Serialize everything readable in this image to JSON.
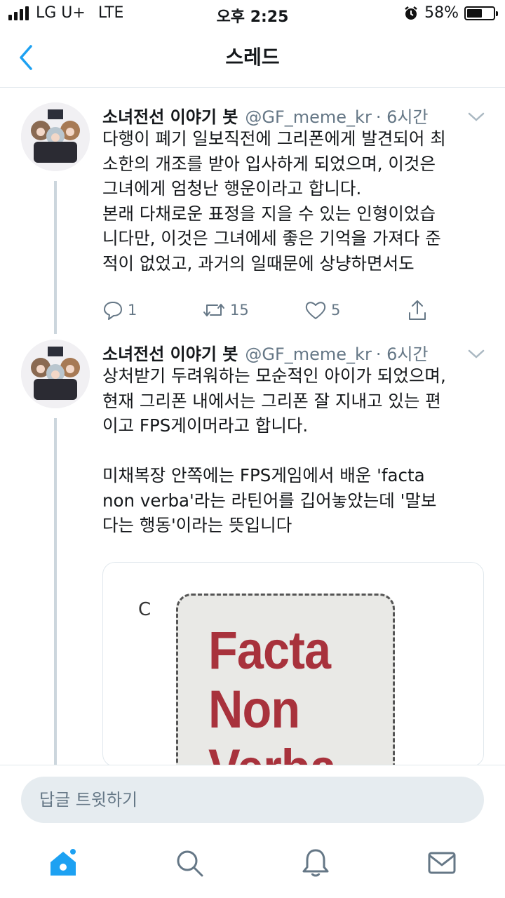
{
  "status_bar": {
    "carrier": "LG U+",
    "network": "LTE",
    "time": "오후 2:25",
    "battery_percent": "58%",
    "battery_level": 0.58,
    "icons": [
      "signal-icon",
      "alarm-icon",
      "battery-icon"
    ]
  },
  "header": {
    "title": "스레드",
    "back_icon": "chevron-left-icon"
  },
  "tweets": [
    {
      "name": "소녀전선 이야기 봇",
      "handle": "@GF_meme_kr",
      "time": "· 6시간",
      "text": "다행이 폐기 일보직전에 그리폰에게 발견되어 최\n소한의 개조를 받아 입사하게 되었으며, 이것은\n그녀에게 엄청난 행운이라고 합니다.\n본래 다채로운 표정을 지을 수 있는 인형이었습\n니다만, 이것은 그녀에세 좋은 기억을 가져다 준\n적이 없었고, 과거의 일때문에 상냥하면서도",
      "reply_count": "1",
      "retweet_count": "15",
      "like_count": "5"
    },
    {
      "name": "소녀전선 이야기 봇",
      "handle": "@GF_meme_kr",
      "time": "· 6시간",
      "text": "상처받기 두려워하는 모순적인 아이가 되었으며,\n현재 그리폰 내에서는 그리폰 잘 지내고 있는 편\n이고 FPS게이머라고 합니다.\n\n미채복장 안쪽에는 FPS게임에서 배운 'facta\nnon verba'라는 라틴어를 깁어놓았는데 '말보\n다는 행동'이라는 뜻입니다",
      "media": {
        "letter": "C",
        "words": [
          "Facta",
          "Non",
          "Verba"
        ]
      }
    }
  ],
  "reply_bar": {
    "placeholder": "답글 트윗하기"
  },
  "tab_bar": {
    "tabs": [
      "home-icon",
      "search-icon",
      "notifications-icon",
      "messages-icon"
    ],
    "accent": "#1da1f2",
    "inactive": "#657786"
  }
}
